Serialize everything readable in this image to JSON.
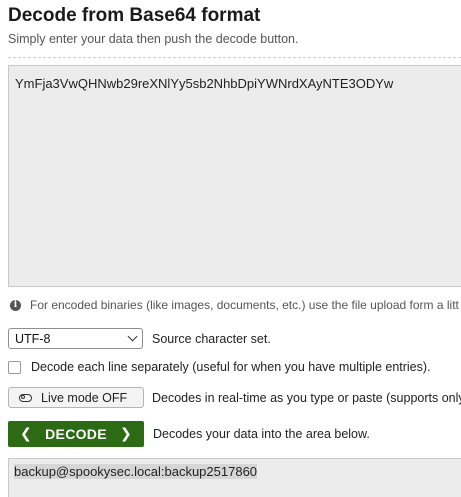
{
  "header": {
    "title": "Decode from Base64 format",
    "subtitle": "Simply enter your data then push the decode button."
  },
  "input": {
    "value": "YmFja3VwQHNwb29reXNlYy5sb2NhbDpiYWNrdXAyNTE3ODYw"
  },
  "info": {
    "icon": "info-icon",
    "text": "For encoded binaries (like images, documents, etc.) use the file upload form a litt"
  },
  "charset": {
    "selected": "UTF-8",
    "label": "Source character set."
  },
  "each_line": {
    "checked": false,
    "label": "Decode each line separately (useful for when you have multiple entries)."
  },
  "live_mode": {
    "button_label": "Live mode OFF",
    "description": "Decodes in real-time as you type or paste (supports only t"
  },
  "decode": {
    "left_arrow": "❮",
    "button_label": "DECODE",
    "right_arrow": "❯",
    "description": "Decodes your data into the area below.",
    "color": "#2d6a14"
  },
  "output": {
    "value": "backup@spookysec.local:backup2517860"
  }
}
